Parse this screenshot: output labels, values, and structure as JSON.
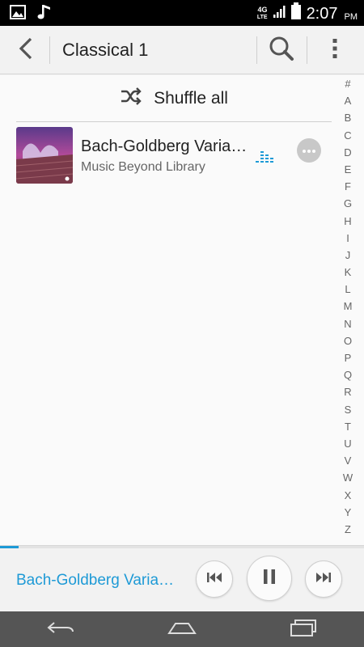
{
  "status_bar": {
    "network": "4G",
    "network_sub": "LTE",
    "time": "2:07",
    "ampm": "PM",
    "icons": [
      "gallery-icon",
      "music-note-icon",
      "signal-icon",
      "battery-icon"
    ]
  },
  "app_bar": {
    "title": "Classical 1",
    "icons": [
      "back-arrow-icon",
      "search-icon",
      "overflow-menu-icon"
    ]
  },
  "shuffle": {
    "label": "Shuffle all",
    "icon": "shuffle-icon"
  },
  "songs": [
    {
      "title": "Bach-Goldberg Variations",
      "artist": "Music Beyond Library",
      "playing": true
    }
  ],
  "alphabet_index": [
    "#",
    "A",
    "B",
    "C",
    "D",
    "E",
    "F",
    "G",
    "H",
    "I",
    "J",
    "K",
    "L",
    "M",
    "N",
    "O",
    "P",
    "Q",
    "R",
    "S",
    "T",
    "U",
    "V",
    "W",
    "X",
    "Y",
    "Z"
  ],
  "now_playing": {
    "title": "Bach-Goldberg Variations",
    "progress": 0.05,
    "controls": [
      "previous-icon",
      "pause-icon",
      "next-icon"
    ]
  },
  "nav_bar": {
    "icons": [
      "back-nav-icon",
      "home-nav-icon",
      "recents-nav-icon"
    ]
  },
  "colors": {
    "accent": "#1e9ad6",
    "status_bar_bg": "#000000",
    "nav_bar_bg": "#555555"
  }
}
